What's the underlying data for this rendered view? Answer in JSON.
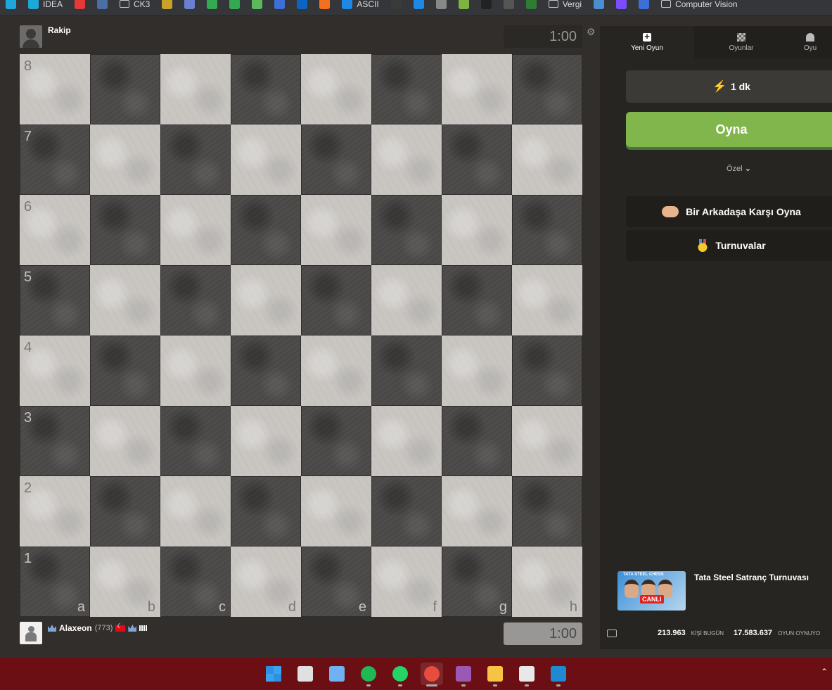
{
  "bookmarks": [
    {
      "label": "",
      "color": "#1ea8d9"
    },
    {
      "label": "IDEA",
      "color": "#1ea8d9"
    },
    {
      "label": "",
      "color": "#e53935"
    },
    {
      "label": "",
      "color": "#4a6fa5"
    },
    {
      "label": "CK3",
      "folder": true
    },
    {
      "label": "",
      "color": "#c9a227"
    },
    {
      "label": "",
      "color": "#6a7fd0"
    },
    {
      "label": "",
      "color": "#34a853"
    },
    {
      "label": "",
      "color": "#34a853"
    },
    {
      "label": "",
      "color": "#5cb85c"
    },
    {
      "label": "",
      "color": "#3d6fd6"
    },
    {
      "label": "",
      "color": "#0a66c2"
    },
    {
      "label": "",
      "color": "#f37021"
    },
    {
      "label": "ASCII",
      "color": "#1e88e5"
    },
    {
      "label": "",
      "color": "#3a3a3a"
    },
    {
      "label": "",
      "color": "#1e88e5"
    },
    {
      "label": "",
      "color": "#888888"
    },
    {
      "label": "",
      "color": "#7cb342"
    },
    {
      "label": "",
      "color": "#222222"
    },
    {
      "label": "",
      "color": "#555555"
    },
    {
      "label": "",
      "color": "#2e7d32"
    },
    {
      "label": "Vergi",
      "folder": true
    },
    {
      "label": "",
      "color": "#4a8fd1"
    },
    {
      "label": "",
      "color": "#7c4dff"
    },
    {
      "label": "",
      "color": "#3d6fd6"
    },
    {
      "label": "Computer Vision",
      "folder": true
    }
  ],
  "opponent": {
    "name": "Rakip",
    "clock": "1:00"
  },
  "player": {
    "name": "Alaxeon",
    "rating": "(773)",
    "clock": "1:00"
  },
  "board": {
    "ranks": [
      "8",
      "7",
      "6",
      "5",
      "4",
      "3",
      "2",
      "1"
    ],
    "files": [
      "a",
      "b",
      "c",
      "d",
      "e",
      "f",
      "g",
      "h"
    ]
  },
  "panel": {
    "tabs": [
      {
        "label": "Yeni Oyun",
        "icon": "plus-icon",
        "active": true
      },
      {
        "label": "Oyunlar",
        "icon": "board-icon",
        "active": false
      },
      {
        "label": "Oyu",
        "icon": "person-icon",
        "active": false
      }
    ],
    "time_control": "1 dk",
    "play_button": "Oyna",
    "custom": "Özel",
    "friend_button": "Bir Arkadaşa Karşı Oyna",
    "tournaments_button": "Turnuvalar",
    "promo": {
      "title": "Tata Steel Satranç Turnuvası",
      "image_caption": "TATA STEEL CHESS",
      "live_badge": "CANLI"
    },
    "stats": {
      "players_today": "213.963",
      "players_today_label": "KİŞİ BUGÜN",
      "games_playing": "17.583.637",
      "games_playing_label": "OYUN OYNUYO"
    }
  },
  "taskbar": [
    {
      "name": "windows-start-icon",
      "color": "#3aa3f0"
    },
    {
      "name": "task-view-icon",
      "color": "#e0e0e0"
    },
    {
      "name": "photos-icon",
      "color": "#6fb1f2"
    },
    {
      "name": "spotify-icon",
      "color": "#1db954"
    },
    {
      "name": "whatsapp-icon",
      "color": "#25d366"
    },
    {
      "name": "chrome-icon",
      "color": "#e74c3c"
    },
    {
      "name": "affinity-icon",
      "color": "#9b59b6"
    },
    {
      "name": "file-explorer-icon",
      "color": "#f6c344"
    },
    {
      "name": "app-icon",
      "color": "#e8e8e8"
    },
    {
      "name": "vscode-icon",
      "color": "#1f8ad2"
    }
  ]
}
